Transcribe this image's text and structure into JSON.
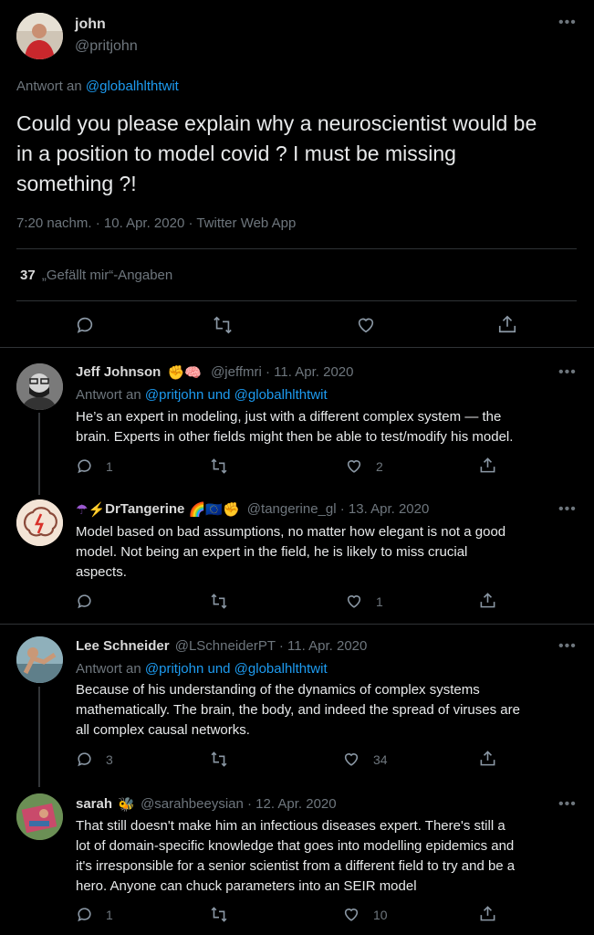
{
  "main_tweet": {
    "name": "john",
    "handle": "@pritjohn",
    "reply_to_prefix": "Antwort an",
    "reply_to_handle": "@globalhlthtwit",
    "text_lines": [
      "Could you please explain why a neuroscientist would be",
      "in a position to model covid ? I must be missing",
      "something ?!"
    ],
    "meta": "7:20 nachm. · 10. Apr. 2020 · Twitter Web App",
    "likes_count": "37",
    "likes_label": "„Gefällt mir“-Angaben"
  },
  "replies": [
    {
      "name": "Jeff Johnson",
      "handle_date": "@jeffmri · 11. Apr. 2020",
      "reply_prefix": "Antwort an",
      "reply_targets": "@pritjohn und @globalhlthtwit",
      "text_lines": [
        "He’s an expert in modeling, just with a different complex system — the",
        "brain. Experts in other fields might then be able to test/modify his model."
      ],
      "reply_count": "1",
      "like_count": "2",
      "emojis": [
        "✊",
        "🧠"
      ]
    },
    {
      "name": "DrTangerine",
      "name_prefix_emojis": [
        "☂",
        "⚡"
      ],
      "name_suffix_emojis": [
        "🌈",
        "🇪🇺",
        "✊"
      ],
      "handle_date": "@tangerine_gl · 13. Apr. 2020",
      "text_lines": [
        "Model based on bad assumptions, no matter how elegant is not a good",
        "model. Not being an expert in the field, he is likely to miss crucial",
        "aspects."
      ],
      "reply_count": "",
      "like_count": "1"
    },
    {
      "name": "Lee Schneider",
      "handle_date": "@LSchneiderPT · 11. Apr. 2020",
      "reply_prefix": "Antwort an",
      "reply_targets": "@pritjohn und @globalhlthtwit",
      "text_lines": [
        "Because of his understanding of the dynamics of complex systems",
        "mathematically. The brain, the body, and indeed the spread of viruses are",
        "all complex causal networks."
      ],
      "reply_count": "3",
      "like_count": "34"
    },
    {
      "name": "sarah",
      "name_suffix_emojis": [
        "🐝"
      ],
      "handle_date": "@sarahbeeysian · 12. Apr. 2020",
      "text_lines": [
        "That still doesn't make him an infectious diseases expert. There's still a",
        "lot of domain-specific knowledge that goes into modelling epidemics and",
        "it's irresponsible for a senior scientist from a different field to try and be a",
        "hero. Anyone can chuck parameters into an SEIR model"
      ],
      "reply_count": "1",
      "like_count": "10"
    }
  ],
  "icons": {
    "more": "more-horizontal-icon",
    "reply": "reply-bubble-icon",
    "retweet": "retweet-icon",
    "like": "heart-icon",
    "share": "share-icon"
  },
  "colors": {
    "background": "#000000",
    "link": "#1d9bf0",
    "muted": "#6e767d",
    "text": "#d9d9d9",
    "divider": "#2f3336"
  }
}
